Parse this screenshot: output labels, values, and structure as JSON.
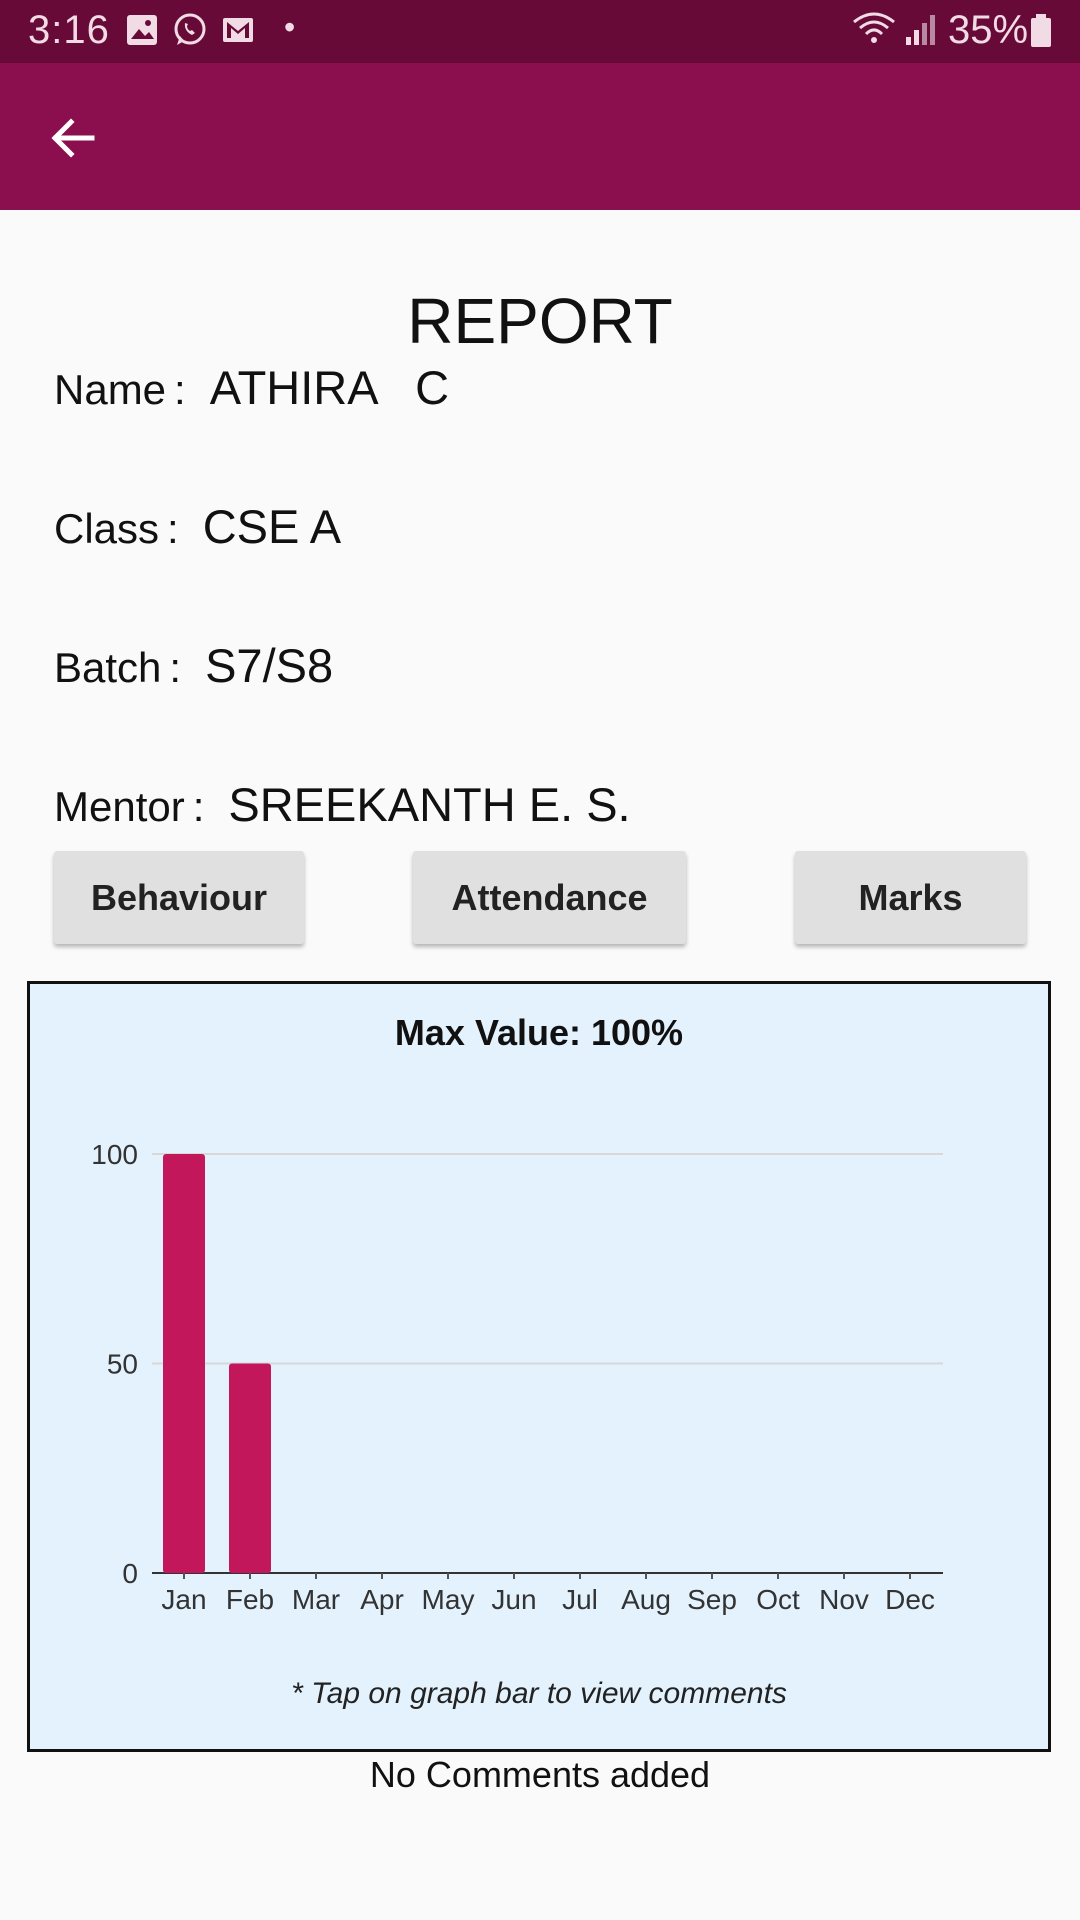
{
  "status_bar": {
    "time": "3:16",
    "battery": "35%",
    "notification_icons": [
      "image-icon",
      "whatsapp-icon",
      "gmail-icon"
    ]
  },
  "app_bar": {
    "back_icon": "arrow-back-icon",
    "color": "#8b0f4e"
  },
  "report": {
    "title": "REPORT",
    "name_label": "Name",
    "name_value": "ATHIRA   C",
    "class_label": "Class",
    "class_value": "CSE A",
    "batch_label": "Batch",
    "batch_value": "S7/S8",
    "mentor_label": "Mentor",
    "mentor_value": "SREEKANTH E. S.",
    "separator": ":"
  },
  "buttons": {
    "behaviour": "Behaviour",
    "attendance": "Attendance",
    "marks": "Marks"
  },
  "chart_data": {
    "type": "bar",
    "title": "Max Value: 100%",
    "categories": [
      "Jan",
      "Feb",
      "Mar",
      "Apr",
      "May",
      "Jun",
      "Jul",
      "Aug",
      "Sep",
      "Oct",
      "Nov",
      "Dec"
    ],
    "values": [
      100,
      50,
      0,
      0,
      0,
      0,
      0,
      0,
      0,
      0,
      0,
      0
    ],
    "yticks": [
      "0",
      "50",
      "100"
    ],
    "ylim": [
      0,
      100
    ],
    "bar_color": "#c2185b",
    "grid": true
  },
  "chart_hint": "* Tap on graph bar to view comments",
  "comments_text": "No Comments added"
}
